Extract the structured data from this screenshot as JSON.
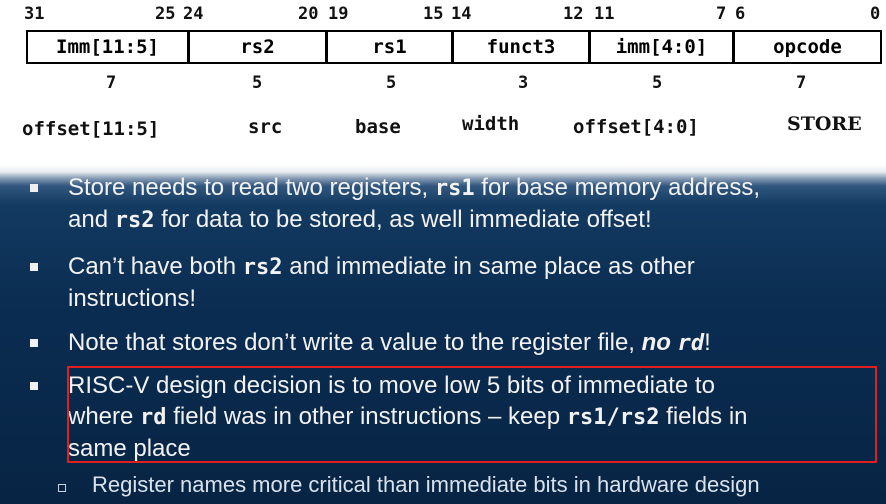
{
  "bit_numbers": [
    "31",
    "25",
    "24",
    "20",
    "19",
    "15",
    "14",
    "12",
    "11",
    "7",
    "6",
    "0"
  ],
  "fields": [
    {
      "name": "Imm[11:5]"
    },
    {
      "name": "rs2"
    },
    {
      "name": "rs1"
    },
    {
      "name": "funct3"
    },
    {
      "name": "imm[4:0]"
    },
    {
      "name": "opcode"
    }
  ],
  "widths": [
    "7",
    "5",
    "5",
    "3",
    "5",
    "7"
  ],
  "labels": [
    "offset[11:5]",
    "src",
    "base",
    "width",
    "offset[4:0]",
    "STORE"
  ],
  "bullets": {
    "b1": {
      "p1": "Store needs to read two registers, ",
      "c1": "rs1",
      "p2": " for base memory address,",
      "p3": "and ",
      "c2": "rs2",
      "p4": " for data to be stored, as well immediate offset!"
    },
    "b2": {
      "p1": "Can’t have both ",
      "c1": "rs2",
      "p2": " and immediate in same place as other",
      "p3": "instructions!"
    },
    "b3": {
      "p1": "Note that stores don’t write a value to the register file, ",
      "bi": "no ",
      "c1": "rd",
      "p2": "!"
    },
    "b4": {
      "p1": "RISC-V design decision is to move low 5 bits of immediate to",
      "p2": "where ",
      "c1": "rd",
      "p3": " field was in other instructions – keep ",
      "c2": "rs1/rs2",
      "p4": " fields in",
      "p5": "same place"
    }
  },
  "sub_bullet": "Register names more critical than immediate bits in hardware design",
  "colors": {
    "highlight_box": "#e02020",
    "background": "#0b2d52"
  }
}
